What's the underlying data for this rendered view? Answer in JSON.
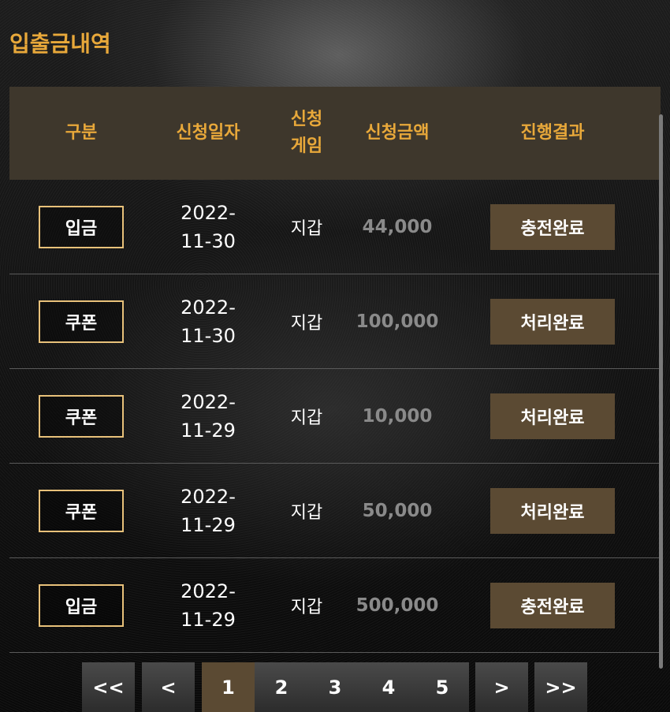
{
  "page": {
    "title": "입출금내역"
  },
  "table": {
    "headers": {
      "type": "구분",
      "date": "신청일자",
      "game": "신청\n게임",
      "amount": "신청금액",
      "result": "진행결과"
    },
    "rows": [
      {
        "type": "입금",
        "date": "2022-\n11-30",
        "game": "지갑",
        "amount": "44,000",
        "result": "충전완료"
      },
      {
        "type": "쿠폰",
        "date": "2022-\n11-30",
        "game": "지갑",
        "amount": "100,000",
        "result": "처리완료"
      },
      {
        "type": "쿠폰",
        "date": "2022-\n11-29",
        "game": "지갑",
        "amount": "10,000",
        "result": "처리완료"
      },
      {
        "type": "쿠폰",
        "date": "2022-\n11-29",
        "game": "지갑",
        "amount": "50,000",
        "result": "처리완료"
      },
      {
        "type": "입금",
        "date": "2022-\n11-29",
        "game": "지갑",
        "amount": "500,000",
        "result": "충전완료"
      }
    ]
  },
  "pagination": {
    "first": "<<",
    "prev": "<",
    "pages": [
      "1",
      "2",
      "3",
      "4",
      "5"
    ],
    "current": "1",
    "next": ">",
    "last": ">>"
  },
  "colors": {
    "accent": "#e8a83a",
    "header_bg": "#3e372c",
    "status_bg": "#5b4a33",
    "type_border": "#e8c17a",
    "amount_text": "#8a8a8a"
  }
}
